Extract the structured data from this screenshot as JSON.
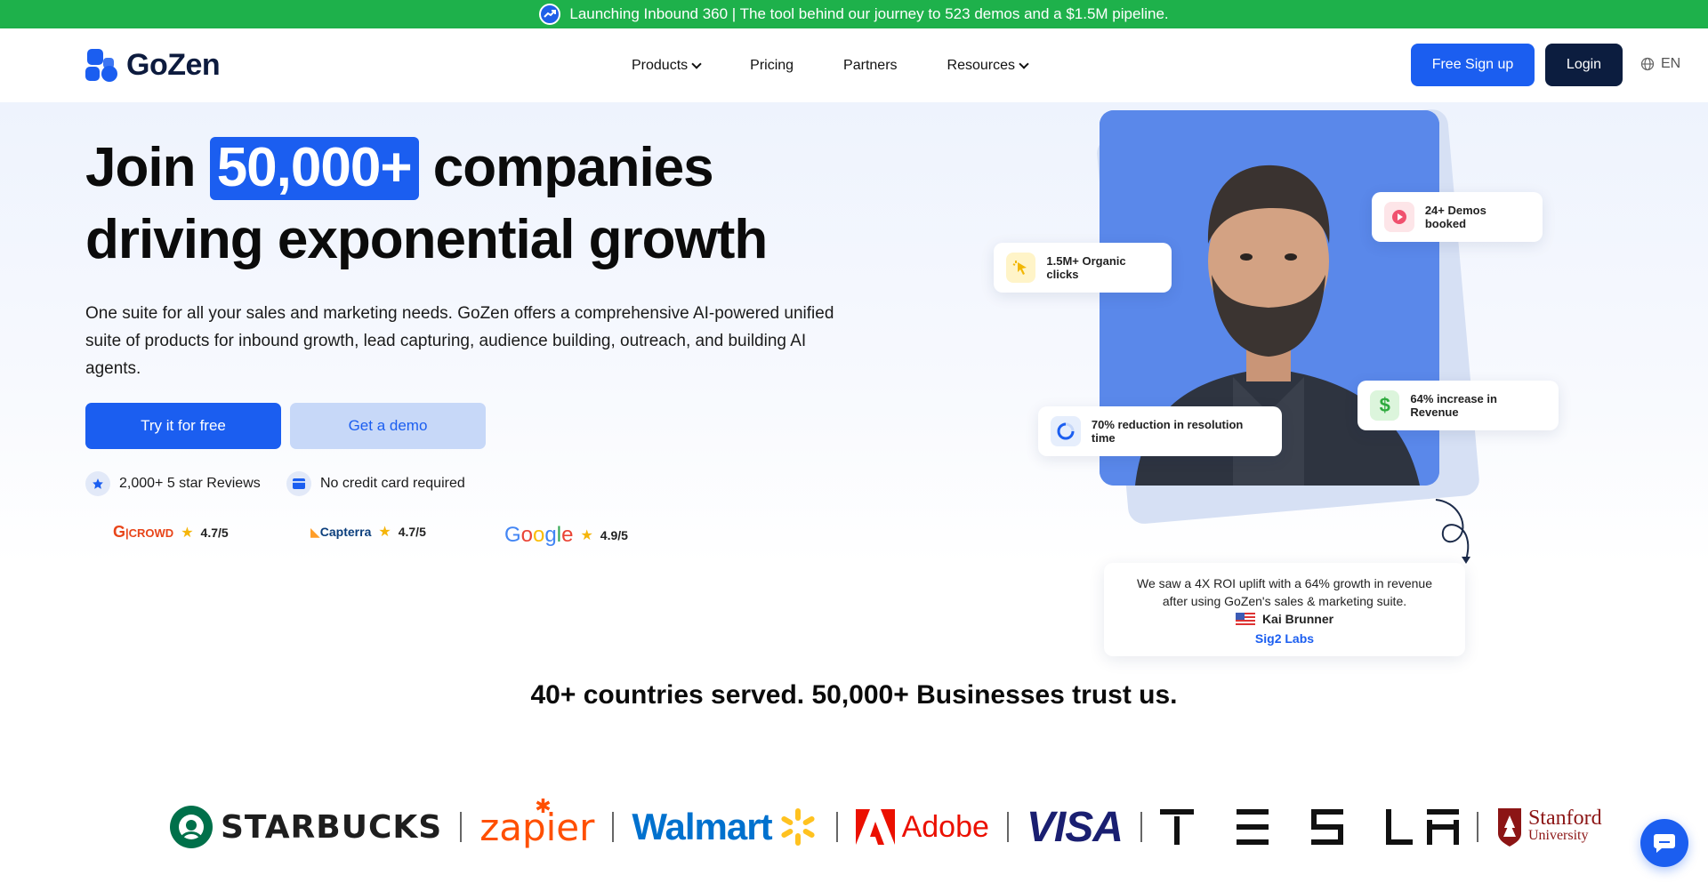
{
  "announcement": {
    "text": "Launching Inbound 360 | The tool behind our journey to 523 demos and a $1.5M pipeline."
  },
  "nav": {
    "logo_text": "GoZen",
    "items": [
      {
        "label": "Products",
        "has_dropdown": true
      },
      {
        "label": "Pricing",
        "has_dropdown": false
      },
      {
        "label": "Partners",
        "has_dropdown": false
      },
      {
        "label": "Resources",
        "has_dropdown": true
      }
    ],
    "signup_label": "Free Sign up",
    "login_label": "Login",
    "language": "EN"
  },
  "hero": {
    "title_pre": "Join",
    "title_highlight": "50,000+",
    "title_post": "companies",
    "title_line2": "driving exponential growth",
    "description": "One suite for all your sales and marketing needs. GoZen offers a comprehensive AI-powered unified suite of products for inbound growth, lead capturing, audience building, outreach, and building AI agents.",
    "cta_primary": "Try it for free",
    "cta_secondary": "Get a demo",
    "perks": [
      "2,000+ 5 star Reviews",
      "No credit card required"
    ],
    "ratings": [
      {
        "source": "G2 CROWD",
        "score": "4.7/5"
      },
      {
        "source": "Capterra",
        "score": "4.7/5"
      },
      {
        "source": "Google",
        "score": "4.9/5"
      }
    ]
  },
  "stats": {
    "demos": "24+ Demos booked",
    "clicks": "1.5M+ Organic clicks",
    "revenue": "64% increase in Revenue",
    "resolution": "70% reduction in resolution time"
  },
  "testimonial": {
    "quote_line1": "We saw a 4X ROI uplift with a 64% growth in revenue",
    "quote_line2": "after using GoZen's sales & marketing suite.",
    "name": "Kai Brunner",
    "company": "Sig2 Labs"
  },
  "trust": {
    "heading": "40+ countries served. 50,000+ Businesses trust us."
  },
  "logos": {
    "starbucks": "STARBUCKS",
    "zapier": "zapier",
    "walmart": "Walmart",
    "adobe": "Adobe",
    "visa": "VISA",
    "tesla": "TESLA",
    "stanford": "Stanford",
    "stanford_sub": "University"
  },
  "colors": {
    "brand_blue": "#1b5ef0",
    "navy": "#0c1d3f",
    "announce_green": "#1eb14b"
  }
}
